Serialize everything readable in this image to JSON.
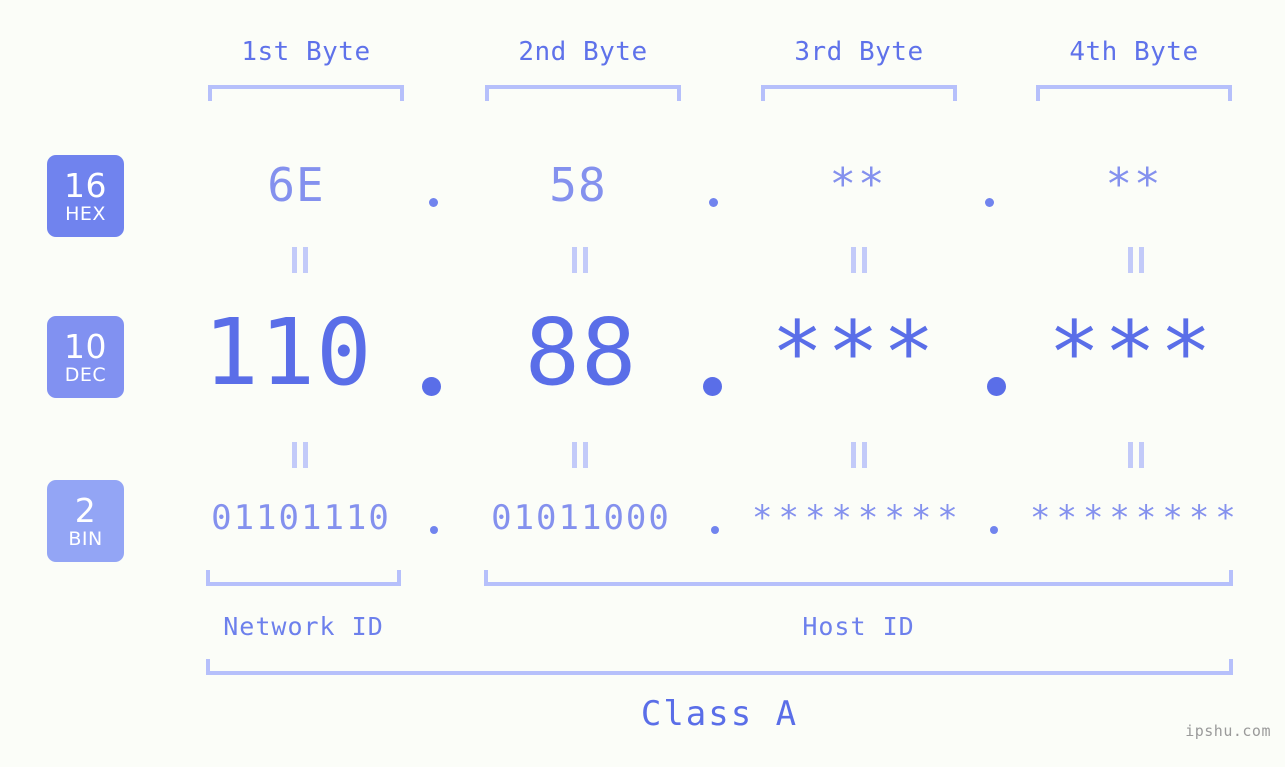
{
  "meta": {
    "watermark": "ipshu.com",
    "background_color": "#fbfdf8",
    "accent_strong": "#5a6ee8",
    "accent_mid": "#8491ee",
    "accent_light": "#b6c0fb"
  },
  "headers": {
    "byte1": "1st Byte",
    "byte2": "2nd Byte",
    "byte3": "3rd Byte",
    "byte4": "4th Byte"
  },
  "bases": [
    {
      "number": "16",
      "name": "HEX",
      "color": "#7083ee"
    },
    {
      "number": "10",
      "name": "DEC",
      "color": "#8191f1"
    },
    {
      "number": "2",
      "name": "BIN",
      "color": "#93a5f5"
    }
  ],
  "rows": {
    "hex": {
      "label_number": "16",
      "label_name": "HEX",
      "values": [
        "6E",
        "58",
        "**",
        "**"
      ],
      "separator": "."
    },
    "dec": {
      "label_number": "10",
      "label_name": "DEC",
      "values": [
        "110",
        "88",
        "***",
        "***"
      ],
      "separator": "."
    },
    "bin": {
      "label_number": "2",
      "label_name": "BIN",
      "values": [
        "01101110",
        "01011000",
        "********",
        "********"
      ],
      "separator": "."
    }
  },
  "footer": {
    "network_id": "Network ID",
    "host_id": "Host ID",
    "class": "Class A"
  }
}
